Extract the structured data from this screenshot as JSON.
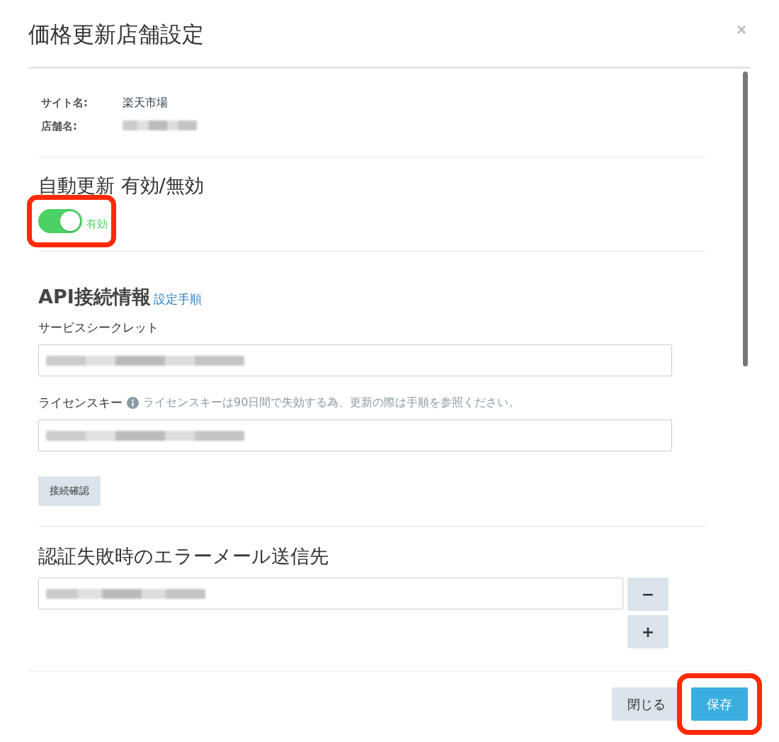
{
  "modal": {
    "title": "価格更新店舗設定",
    "close": "×"
  },
  "site": {
    "label": "サイト名:",
    "value": "楽天市場"
  },
  "shop": {
    "label": "店舗名:",
    "redacted": true
  },
  "auto_update": {
    "heading": "自動更新 有効/無効",
    "on": true,
    "state_label": "有効",
    "highlighted": true
  },
  "api": {
    "heading": "API接続情報",
    "link": "設定手順",
    "fields": [
      {
        "label": "サービスシークレット",
        "redacted": true
      },
      {
        "label": "ライセンスキー",
        "hint": "ライセンスキーは90日間で失効する為、更新の際は手順を参照ください。",
        "redacted": true
      }
    ],
    "test_button": "接続確認"
  },
  "error_mail": {
    "heading": "認証失敗時のエラーメール送信先",
    "redacted": true,
    "remove": "−",
    "add": "+"
  },
  "footer": {
    "buttons": [
      {
        "label": "閉じる",
        "kind": "default",
        "highlighted": false
      },
      {
        "label": "保存",
        "kind": "primary",
        "highlighted": true
      }
    ]
  }
}
